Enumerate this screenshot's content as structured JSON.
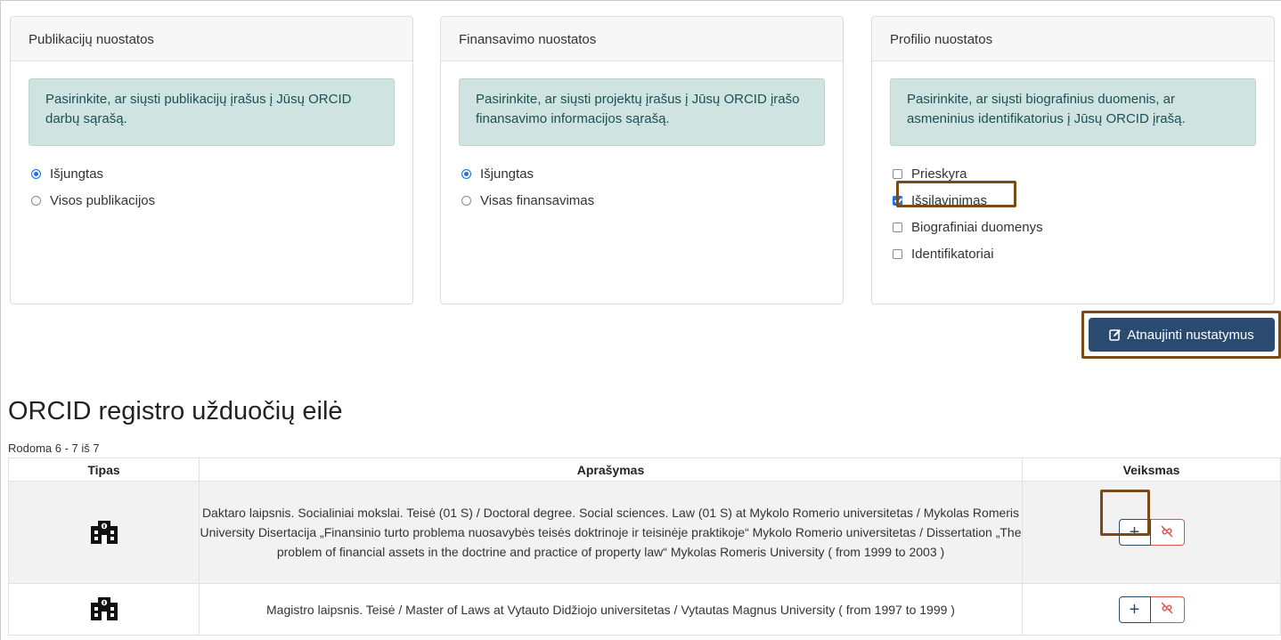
{
  "publications": {
    "title": "Publikacijų nuostatos",
    "info": "Pasirinkite, ar siųsti publikacijų įrašus į Jūsų ORCID darbų sąrašą.",
    "options": [
      {
        "label": "Išjungtas",
        "selected": true
      },
      {
        "label": "Visos publikacijos",
        "selected": false
      }
    ]
  },
  "funding": {
    "title": "Finansavimo nuostatos",
    "info": "Pasirinkite, ar siųsti projektų įrašus į Jūsų ORCID įrašo finansavimo informacijos sąrašą.",
    "options": [
      {
        "label": "Išjungtas",
        "selected": true
      },
      {
        "label": "Visas finansavimas",
        "selected": false
      }
    ]
  },
  "profile": {
    "title": "Profilio nuostatos",
    "info": "Pasirinkite, ar siųsti biografinius duomenis, ar asmeninius identifikatorius į Jūsų ORCID įrašą.",
    "options": [
      {
        "label": "Prieskyra",
        "checked": false
      },
      {
        "label": "Išsilavinimas",
        "checked": true
      },
      {
        "label": "Biografiniai duomenys",
        "checked": false
      },
      {
        "label": "Identifikatoriai",
        "checked": false
      }
    ]
  },
  "update_button": "Atnaujinti nustatymus",
  "queue": {
    "title": "ORCID registro užduočių eilė",
    "count": "Rodoma 6 - 7 iš 7",
    "headers": [
      "Tipas",
      "Aprašymas",
      "Veiksmas"
    ],
    "rows": [
      {
        "type_icon": "building-icon",
        "description": "Daktaro laipsnis. Socialiniai mokslai. Teisė (01 S) / Doctoral degree. Social sciences. Law (01 S) at Mykolo Romerio universitetas / Mykolas Romeris University Disertacija „Finansinio turto problema nuosavybės teisės doktrinoje ir teisinėje praktikoje“ Mykolo Romerio universitetas / Dissertation „The problem of financial assets in the doctrine and practice of property law“ Mykolas Romeris University ( from 1999 to 2003 )",
        "add_label": "+"
      },
      {
        "type_icon": "building-icon",
        "description": "Magistro laipsnis. Teisė / Master of Laws at Vytauto Didžiojo universitetas / Vytautas Magnus University ( from 1997 to 1999 )",
        "add_label": "+"
      }
    ]
  },
  "colors": {
    "primary": "#2a4a70",
    "info_bg": "#cfe4e1",
    "highlight": "#7a4a16",
    "danger": "#d9534f"
  }
}
